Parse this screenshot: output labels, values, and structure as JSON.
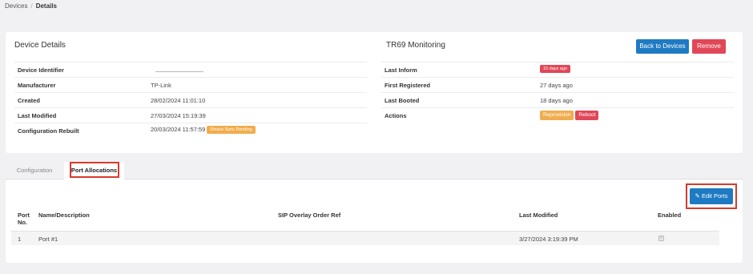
{
  "breadcrumb": {
    "parent": "Devices",
    "separator": "/",
    "current": "Details"
  },
  "device_details": {
    "title": "Device Details",
    "rows": [
      {
        "label": "Device Identifier",
        "value": ""
      },
      {
        "label": "Manufacturer",
        "value": "TP-Link"
      },
      {
        "label": "Created",
        "value": "28/02/2024 11:01:10"
      },
      {
        "label": "Last Modified",
        "value": "27/03/2024 15:19:39"
      },
      {
        "label": "Configuration Rebuilt",
        "value": "20/03/2024 11:57:59",
        "badge": "Device Sync Pending"
      }
    ]
  },
  "tr69": {
    "title": "TR69 Monitoring",
    "rows": [
      {
        "label": "Last Inform",
        "badge": "15 days ago"
      },
      {
        "label": "First Registered",
        "value": "27 days ago"
      },
      {
        "label": "Last Booted",
        "value": "18 days ago"
      },
      {
        "label": "Actions",
        "actions": [
          "Reprovision",
          "Reboot"
        ]
      }
    ]
  },
  "header_buttons": {
    "back": "Back to Devices",
    "remove": "Remove"
  },
  "tabs": [
    {
      "label": "Configuration"
    },
    {
      "label": "Port Allocations",
      "active": true
    }
  ],
  "edit_ports": {
    "label": "Edit Ports",
    "icon": "pencil-icon"
  },
  "ports_table": {
    "columns": {
      "port_no_1": "Port",
      "port_no_2": "No.",
      "name": "Name/Description",
      "sip": "SIP Overlay Order Ref",
      "modified": "Last Modified",
      "enabled": "Enabled"
    },
    "rows": [
      {
        "port": "1",
        "name": "Port #1",
        "sip": "",
        "modified": "3/27/2024 3:19:39 PM",
        "enabled": true
      }
    ]
  },
  "colors": {
    "primary": "#1e7ac2",
    "danger": "#e04757",
    "warning": "#f0ad4e",
    "highlight": "#d83b2b"
  }
}
